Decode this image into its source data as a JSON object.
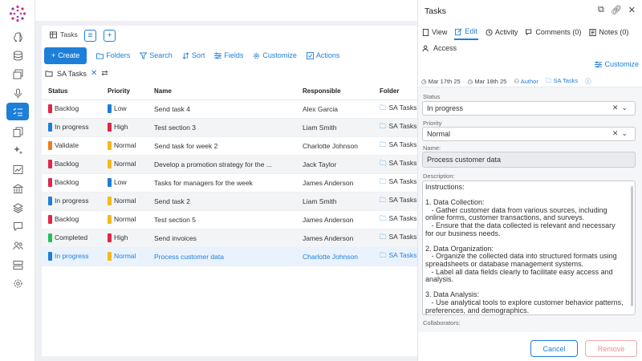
{
  "colors": {
    "accent": "#1e7fd8",
    "red": "#e0264a",
    "blue": "#1e7fd8",
    "orange": "#f07c1e",
    "green": "#22c060",
    "yellow": "#f5b91a"
  },
  "rail": {
    "icons": [
      "brain-icon",
      "database-icon",
      "gallery-icon",
      "microphone-icon",
      "tasks-icon",
      "copy-icon",
      "sparkle-icon",
      "chart-icon",
      "bank-icon",
      "stack-icon",
      "chat-icon",
      "users-icon",
      "server-icon",
      "gear-icon"
    ],
    "active": "tasks-icon"
  },
  "main": {
    "tab_label": "Tasks",
    "toolbar": {
      "create": "Create",
      "folders": "Folders",
      "search": "Search",
      "sort": "Sort",
      "fields": "Fields",
      "customize": "Customize",
      "actions": "Actions"
    },
    "filter_label": "SA Tasks",
    "columns": [
      "Status",
      "Priority",
      "Name",
      "Responsible",
      "Folder"
    ],
    "rows": [
      {
        "status": "Backlog",
        "status_color": "#e0264a",
        "priority": "Low",
        "priority_color": "#1e7fd8",
        "name": "Send task 4",
        "responsible": "Alex Garcia",
        "folder": "SA Tasks"
      },
      {
        "status": "In progress",
        "status_color": "#1e7fd8",
        "priority": "High",
        "priority_color": "#e0264a",
        "name": "Test section 3",
        "responsible": "Liam Smith",
        "folder": "SA Tasks"
      },
      {
        "status": "Validate",
        "status_color": "#f07c1e",
        "priority": "Normal",
        "priority_color": "#f5b91a",
        "name": "Send task for week 2",
        "responsible": "Charlotte Johnson",
        "folder": "SA Tasks"
      },
      {
        "status": "Backlog",
        "status_color": "#e0264a",
        "priority": "Normal",
        "priority_color": "#f5b91a",
        "name": "Develop a promotion strategy for the ...",
        "responsible": "Jack Taylor",
        "folder": "SA Tasks"
      },
      {
        "status": "Backlog",
        "status_color": "#e0264a",
        "priority": "Low",
        "priority_color": "#1e7fd8",
        "name": "Tasks for managers for the week",
        "responsible": "James Anderson",
        "folder": "SA Tasks"
      },
      {
        "status": "In progress",
        "status_color": "#1e7fd8",
        "priority": "Normal",
        "priority_color": "#f5b91a",
        "name": "Send task 2",
        "responsible": "Liam Smith",
        "folder": "SA Tasks"
      },
      {
        "status": "Backlog",
        "status_color": "#e0264a",
        "priority": "Normal",
        "priority_color": "#f5b91a",
        "name": "Test section 5",
        "responsible": "James Anderson",
        "folder": "SA Tasks"
      },
      {
        "status": "Completed",
        "status_color": "#22c060",
        "priority": "High",
        "priority_color": "#e0264a",
        "name": "Send invoices",
        "responsible": "James Anderson",
        "folder": "SA Tasks"
      },
      {
        "status": "In progress",
        "status_color": "#1e7fd8",
        "priority": "Normal",
        "priority_color": "#f5b91a",
        "name": "Process customer data",
        "responsible": "Charlotte Johnson",
        "folder": "SA Tasks"
      }
    ]
  },
  "panel": {
    "title": "Tasks",
    "tabs": {
      "view": "View",
      "edit": "Edit",
      "activity": "Activity",
      "comments": "Comments (0)",
      "notes": "Notes (0)",
      "access": "Access"
    },
    "customize": "Customize",
    "meta": {
      "start": "Mar 17th 25",
      "end": "Mar 18th 25",
      "author": "Author",
      "folder": "SA Tasks"
    },
    "status_label": "Status",
    "status_value": "In progress",
    "priority_label": "Priority",
    "priority_value": "Normal",
    "name_label": "Name:",
    "name_value": "Process customer data",
    "description_label": "Description:",
    "description": "Instructions:\n\n1. Data Collection:\n   - Gather customer data from various sources, including online forms, customer transactions, and surveys.\n   - Ensure that the data collected is relevant and necessary for our business needs.\n\n2. Data Organization:\n   - Organize the collected data into structured formats using spreadsheets or database management systems.\n   - Label all data fields clearly to facilitate easy access and analysis.\n\n3. Data Analysis:\n   - Use analytical tools to explore customer behavior patterns, preferences, and demographics.\n   - Identify key insights that could help in tailoring our",
    "collaborators_label": "Collaborators:",
    "cancel": "Cancel",
    "remove": "Remove"
  }
}
